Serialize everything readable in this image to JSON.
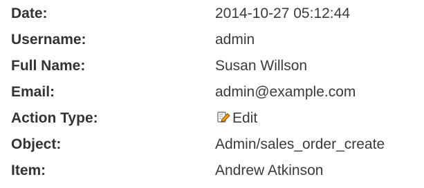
{
  "details": {
    "date": {
      "label": "Date:",
      "value": "2014-10-27 05:12:44"
    },
    "username": {
      "label": "Username:",
      "value": "admin"
    },
    "full_name": {
      "label": "Full Name:",
      "value": "Susan Willson"
    },
    "email": {
      "label": "Email:",
      "value": "admin@example.com"
    },
    "action_type": {
      "label": "Action Type:",
      "value": "Edit",
      "icon": "edit-icon"
    },
    "object": {
      "label": "Object:",
      "value": "Admin/sales_order_create"
    },
    "item": {
      "label": "Item:",
      "value": "Andrew Atkinson"
    }
  }
}
